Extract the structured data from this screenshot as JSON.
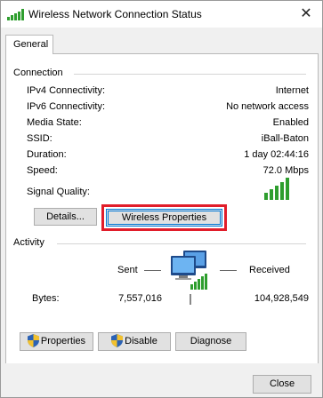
{
  "window": {
    "title": "Wireless Network Connection Status",
    "close_glyph": "✕"
  },
  "tabs": [
    {
      "label": "General",
      "selected": true
    }
  ],
  "connection": {
    "group_label": "Connection",
    "rows": [
      {
        "label": "IPv4 Connectivity:",
        "value": "Internet"
      },
      {
        "label": "IPv6 Connectivity:",
        "value": "No network access"
      },
      {
        "label": "Media State:",
        "value": "Enabled"
      },
      {
        "label": "SSID:",
        "value": "iBall-Baton"
      },
      {
        "label": "Duration:",
        "value": "1 day 02:44:16"
      },
      {
        "label": "Speed:",
        "value": "72.0 Mbps"
      }
    ],
    "signal_label": "Signal Quality:",
    "signal_bars": 5,
    "buttons": {
      "details": "Details...",
      "wireless_properties": "Wireless Properties"
    }
  },
  "activity": {
    "group_label": "Activity",
    "sent_label": "Sent",
    "received_label": "Received",
    "bytes_label": "Bytes:",
    "bytes_sent": "7,557,016",
    "bytes_received": "104,928,549"
  },
  "actions": {
    "properties": "Properties",
    "disable": "Disable",
    "diagnose": "Diagnose"
  },
  "footer": {
    "close": "Close"
  },
  "colors": {
    "signal_green": "#2e9e2e",
    "highlight_red": "#e11d2a",
    "focus_blue": "#0078d7"
  }
}
